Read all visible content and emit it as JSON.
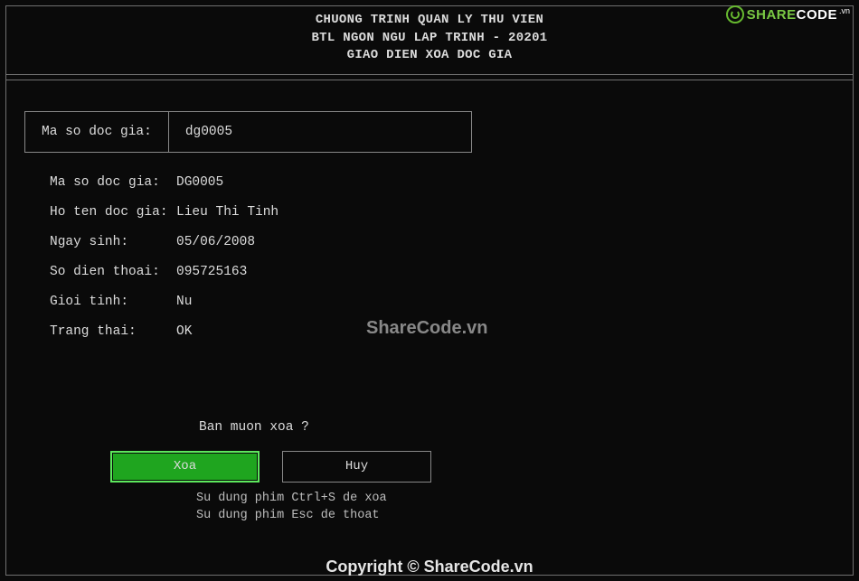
{
  "header": {
    "line1": "CHUONG TRINH QUAN LY THU VIEN",
    "line2": "BTL NGON NGU LAP TRINH - 20201",
    "line3": "GIAO DIEN XOA DOC GIA"
  },
  "input": {
    "label": "Ma so doc gia:",
    "value": "dg0005"
  },
  "details": {
    "ma_so_label": "Ma so doc gia:",
    "ma_so_value": "DG0005",
    "ho_ten_label": "Ho ten doc gia:",
    "ho_ten_value": "Lieu Thi Tinh",
    "ngay_sinh_label": "Ngay sinh:",
    "ngay_sinh_value": "05/06/2008",
    "sdt_label": "So dien thoai:",
    "sdt_value": "095725163",
    "gioi_tinh_label": "Gioi tinh:",
    "gioi_tinh_value": "Nu",
    "trang_thai_label": "Trang thai:",
    "trang_thai_value": "OK"
  },
  "confirm": {
    "prompt": "Ban muon xoa ?",
    "xoa_label": "Xoa",
    "huy_label": "Huy",
    "hint1": "Su dung phim Ctrl+S de xoa",
    "hint2": "Su dung phim Esc de thoat"
  },
  "watermark": {
    "center": "ShareCode.vn",
    "bottom": "Copyright © ShareCode.vn",
    "logo_share": "SHARE",
    "logo_code": "CODE",
    "logo_vn": ".vn"
  }
}
